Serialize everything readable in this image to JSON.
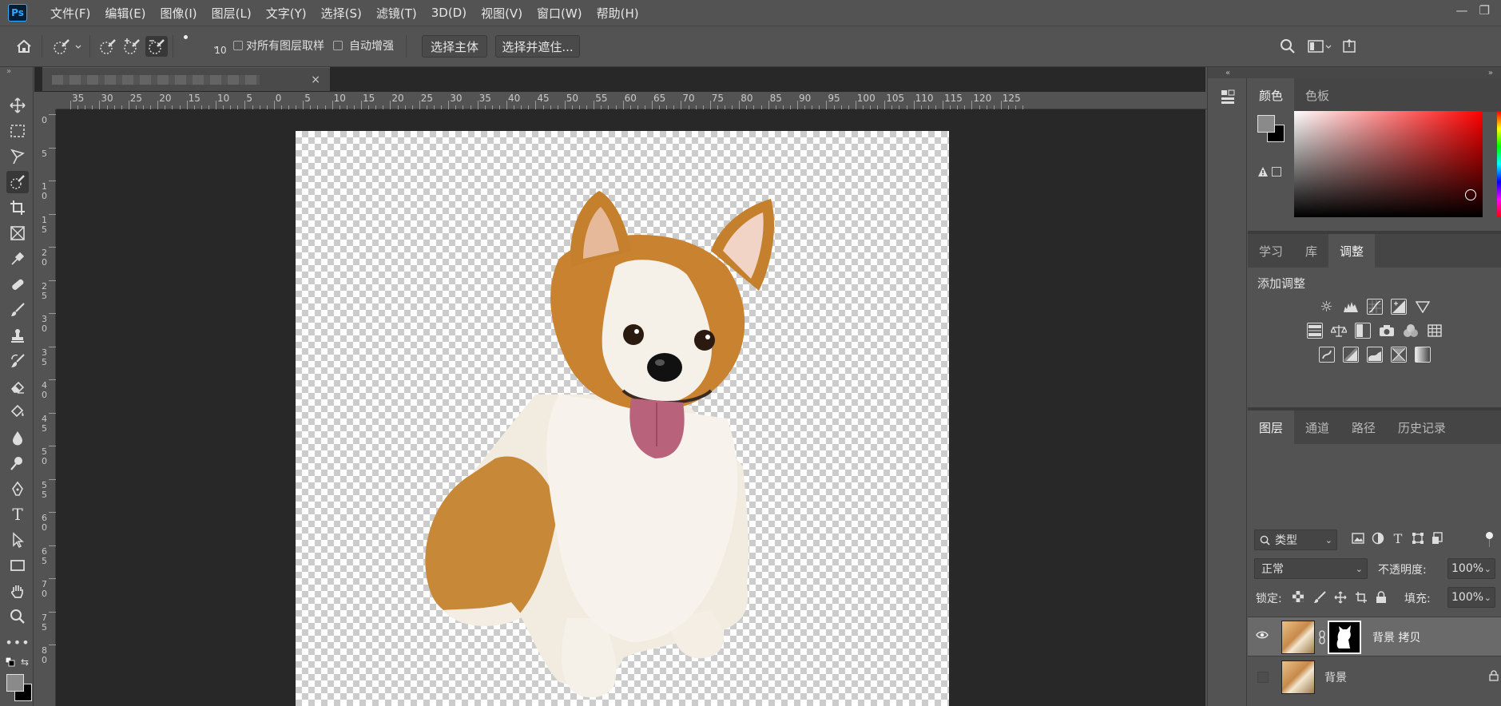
{
  "app": {
    "logo": "Ps"
  },
  "menu": [
    "文件(F)",
    "编辑(E)",
    "图像(I)",
    "图层(L)",
    "文字(Y)",
    "选择(S)",
    "滤镜(T)",
    "3D(D)",
    "视图(V)",
    "窗口(W)",
    "帮助(H)"
  ],
  "window_controls": {
    "minimize": "—",
    "restore": "❐"
  },
  "options": {
    "brush_size": "10",
    "sample_all_layers": "对所有图层取样",
    "auto_enhance": "自动增强",
    "select_subject": "选择主体",
    "select_and_mask": "选择并遮住..."
  },
  "document": {
    "close": "×"
  },
  "ruler": {
    "h_labels": [
      "35",
      "30",
      "25",
      "20",
      "15",
      "10",
      "5",
      "0",
      "5",
      "10",
      "15",
      "20",
      "25",
      "30",
      "35",
      "40",
      "45",
      "50",
      "55",
      "60",
      "65",
      "70",
      "75",
      "80",
      "85",
      "90",
      "95",
      "100",
      "105",
      "110",
      "115",
      "120",
      "125"
    ],
    "v_labels": [
      "0",
      "5",
      "1\n0",
      "1\n5",
      "2\n0",
      "2\n5",
      "3\n0",
      "3\n5",
      "4\n0",
      "4\n5",
      "5\n0",
      "5\n5",
      "6\n0",
      "6\n5",
      "7\n0",
      "7\n5",
      "8\n0"
    ]
  },
  "color_panel": {
    "tabs": [
      "颜色",
      "色板"
    ],
    "active_tab": "颜色",
    "fg_color": "#8a8a8a",
    "bg_color": "#000000",
    "picker_hue": "#ff0000"
  },
  "adjustments_panel": {
    "tabs": [
      "学习",
      "库",
      "调整"
    ],
    "active_tab": "调整",
    "title": "添加调整",
    "row1": [
      "brightness-icon",
      "levels-icon",
      "curves-icon",
      "exposure-icon",
      "vibrance-icon"
    ],
    "row2": [
      "hue-saturation-icon",
      "color-balance-icon",
      "black-white-icon",
      "photo-filter-icon",
      "channel-mixer-icon",
      "color-lookup-icon"
    ],
    "row3": [
      "invert-icon",
      "posterize-icon",
      "threshold-icon",
      "selective-color-icon",
      "gradient-map-icon"
    ]
  },
  "layers_panel": {
    "tabs": [
      "图层",
      "通道",
      "路径",
      "历史记录"
    ],
    "active_tab": "图层",
    "filter_label": "类型",
    "blend_mode": "正常",
    "opacity_label": "不透明度:",
    "opacity": "100%",
    "lock_label": "锁定:",
    "fill_label": "填充:",
    "fill": "100%",
    "layers": [
      {
        "name": "背景 拷贝",
        "visible": true,
        "has_mask": true,
        "selected": true
      },
      {
        "name": "背景",
        "visible": false,
        "has_mask": false,
        "selected": false,
        "locked": true
      }
    ]
  },
  "colors": {
    "panel_bg": "#535353",
    "canvas_bg": "#282828",
    "ps_blue": "#31a8ff"
  }
}
